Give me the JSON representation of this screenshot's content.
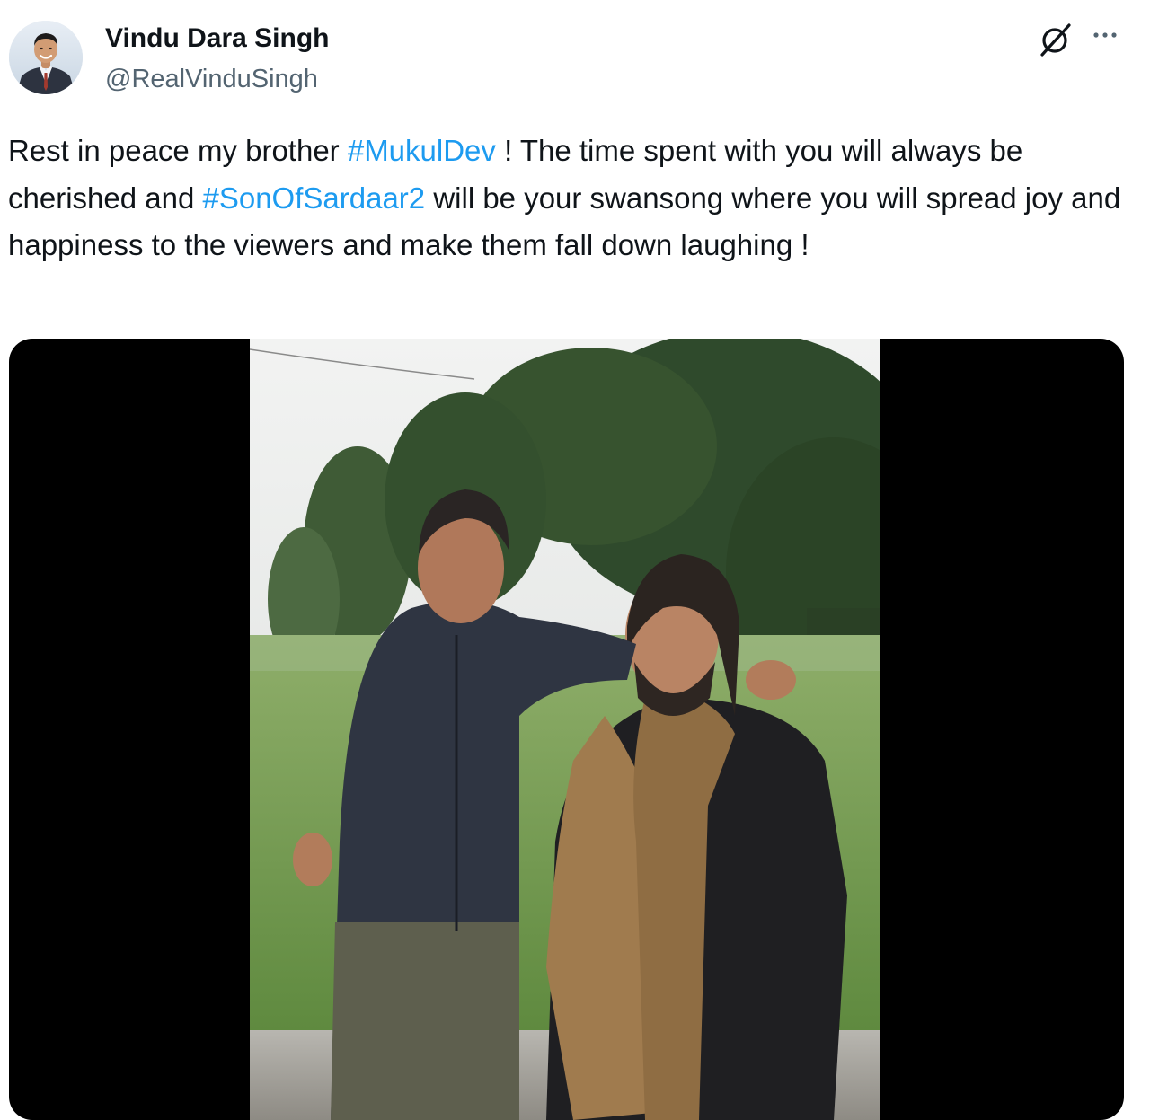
{
  "author": {
    "display_name": "Vindu Dara Singh",
    "handle": "@RealVinduSingh"
  },
  "icons": {
    "grok": "grok-icon",
    "more": "more-options-icon"
  },
  "tweet": {
    "text_1": "Rest in peace my brother ",
    "hashtag_1": "#MukulDev",
    "text_2": " ! The time spent with you will always be cherished and ",
    "hashtag_2": "#SonOfSardaar2",
    "text_3": " will be your swansong where you will spread joy and happiness to the viewers and make them fall down laughing !"
  },
  "colors": {
    "text": "#0f1419",
    "secondary": "#536471",
    "link": "#1d9bf0",
    "media_background": "#000000"
  }
}
